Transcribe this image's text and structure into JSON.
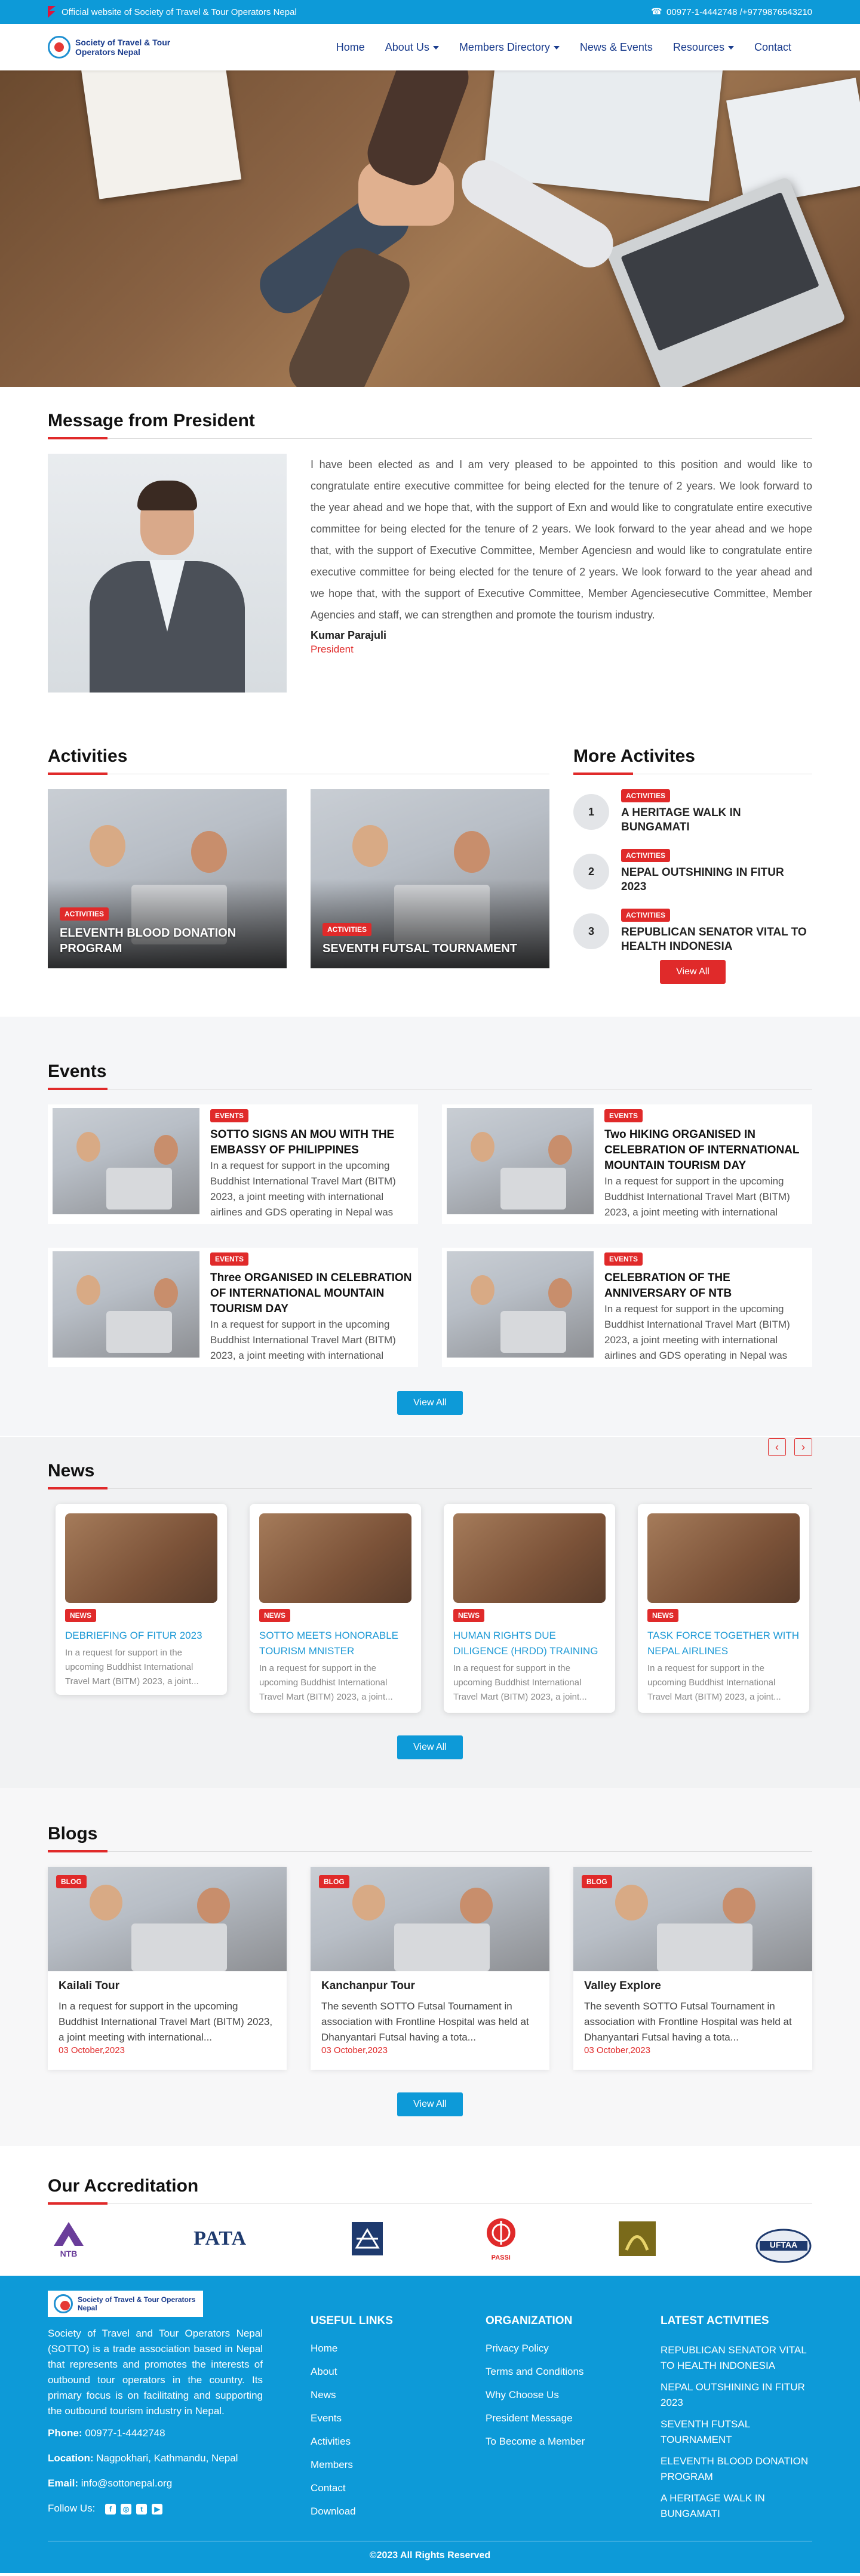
{
  "topbar": {
    "official_text": "Official website of Society of Travel & Tour Operators Nepal",
    "phones": "00977-1-4442748 /+9779876543210"
  },
  "header": {
    "logo_text": "Society of Travel & Tour Operators Nepal",
    "nav": [
      {
        "label": "Home",
        "dropdown": false
      },
      {
        "label": "About Us",
        "dropdown": true
      },
      {
        "label": "Members Directory",
        "dropdown": true
      },
      {
        "label": "News & Events",
        "dropdown": false
      },
      {
        "label": "Resources",
        "dropdown": true
      },
      {
        "label": "Contact",
        "dropdown": false
      }
    ]
  },
  "president": {
    "title": "Message from President",
    "message": "I have been elected as and I am very pleased to be appointed to this position and would like to congratulate entire executive committee for being elected for the tenure of 2 years. We look forward to the year ahead and we hope that, with the support of Exn and would like to congratulate entire executive committee for being elected for the tenure of 2 years. We look forward to the year ahead and we hope that, with the support of Executive Committee, Member Agenciesn and would like to congratulate entire executive committee for being elected for the tenure of 2 years. We look forward to the year ahead and we hope that, with the support of Executive Committee, Member Agenciesecutive Committee, Member Agencies and staff, we can strengthen and promote the tourism industry.",
    "name": "Kumar Parajuli",
    "role": "President"
  },
  "activities": {
    "title": "Activities",
    "cards": [
      {
        "badge": "ACTIVITIES",
        "title": "ELEVENTH BLOOD DONATION PROGRAM"
      },
      {
        "badge": "ACTIVITIES",
        "title": "SEVENTH FUTSAL TOURNAMENT"
      }
    ]
  },
  "more_activities": {
    "title": "More Activites",
    "items": [
      {
        "num": "1",
        "badge": "ACTIVITIES",
        "title": "A HERITAGE WALK IN BUNGAMATI"
      },
      {
        "num": "2",
        "badge": "ACTIVITIES",
        "title": "NEPAL OUTSHINING IN FITUR 2023"
      },
      {
        "num": "3",
        "badge": "ACTIVITIES",
        "title": "REPUBLICAN SENATOR VITAL TO HEALTH INDONESIA"
      }
    ],
    "view_all": "View All"
  },
  "events": {
    "title": "Events",
    "items": [
      {
        "badge": "EVENTS",
        "title": "SOTTO SIGNS AN MOU WITH THE EMBASSY OF PHILIPPINES",
        "desc": "In a request for support in the upcoming Buddhist International Travel Mart (BITM) 2023, a joint meeting with international airlines and GDS operating in Nepal was held"
      },
      {
        "badge": "EVENTS",
        "title": "Two HIKING ORGANISED IN CELEBRATION OF INTERNATIONAL MOUNTAIN TOURISM DAY",
        "desc": "In a request for support in the upcoming Buddhist International Travel Mart (BITM) 2023, a joint meeting with international airlines and GDS operating in Nepal was held"
      },
      {
        "badge": "EVENTS",
        "title": "Three ORGANISED IN CELEBRATION OF INTERNATIONAL MOUNTAIN TOURISM DAY",
        "desc": "In a request for support in the upcoming Buddhist International Travel Mart (BITM) 2023, a joint meeting with international airlines and GDS operating in Nepal was held"
      },
      {
        "badge": "EVENTS",
        "title": "CELEBRATION OF THE ANNIVERSARY OF NTB",
        "desc": "In a request for support in the upcoming Buddhist International Travel Mart (BITM) 2023, a joint meeting with international airlines and GDS operating in Nepal was held"
      }
    ],
    "view_all": "View All"
  },
  "news": {
    "title": "News",
    "prev": "‹",
    "next": "›",
    "items": [
      {
        "badge": "NEWS",
        "title": "DEBRIEFING OF FITUR 2023",
        "desc": "In a request for support in the upcoming Buddhist International Travel Mart (BITM) 2023, a joint..."
      },
      {
        "badge": "NEWS",
        "title": "SOTTO MEETS HONORABLE TOURISM MNISTER",
        "desc": "In a request for support in the upcoming Buddhist International Travel Mart (BITM) 2023, a joint..."
      },
      {
        "badge": "NEWS",
        "title": "HUMAN RIGHTS DUE DILIGENCE (HRDD) TRAINING",
        "desc": "In a request for support in the upcoming Buddhist International Travel Mart (BITM) 2023, a joint..."
      },
      {
        "badge": "NEWS",
        "title": "TASK FORCE TOGETHER WITH NEPAL AIRLINES",
        "desc": "In a request for support in the upcoming Buddhist International Travel Mart (BITM) 2023, a joint..."
      }
    ],
    "view_all": "View All"
  },
  "blogs": {
    "title": "Blogs",
    "items": [
      {
        "badge": "BLOG",
        "title": "Kailali Tour",
        "desc": "In a request for support in the upcoming Buddhist International Travel Mart (BITM) 2023, a joint meeting with international...",
        "date": "03 October,2023"
      },
      {
        "badge": "BLOG",
        "title": "Kanchanpur Tour",
        "desc": "The seventh SOTTO Futsal Tournament in association with Frontline Hospital was held at Dhanyantari Futsal having a tota...",
        "date": "03 October,2023"
      },
      {
        "badge": "BLOG",
        "title": "Valley Explore",
        "desc": "The seventh SOTTO Futsal Tournament in association with Frontline Hospital was held at Dhanyantari Futsal having a tota...",
        "date": "03 October,2023"
      }
    ],
    "view_all": "View All"
  },
  "accreditation": {
    "title": "Our Accreditation",
    "logos": [
      {
        "label": "NTB",
        "color": "#6a3d9a"
      },
      {
        "label": "PATA",
        "color": "#1e3a6e"
      },
      {
        "label": "",
        "color": "#1e3a6e"
      },
      {
        "label": "PASSI",
        "color": "#e02a2a"
      },
      {
        "label": "",
        "color": "#7a6a1a"
      },
      {
        "label": "UFTAA",
        "color": "#1e3a6e"
      }
    ]
  },
  "footer": {
    "logo_text": "Society of Travel & Tour Operators Nepal",
    "about": "Society of Travel and Tour Operators Nepal (SOTTO) is a trade association based in Nepal that represents and promotes the interests of outbound tour operators in the country. Its primary focus is on facilitating and supporting the outbound tourism industry in Nepal.",
    "phone_label": "Phone:",
    "phone": "00977-1-4442748",
    "location_label": "Location:",
    "location": "Nagpokhari, Kathmandu, Nepal",
    "email_label": "Email:",
    "email": "info@sottonepal.org",
    "follow": "Follow Us:",
    "useful_title": "USEFUL LINKS",
    "useful": [
      "Home",
      "About",
      "News",
      "Events",
      "Activities",
      "Members",
      "Contact",
      "Download"
    ],
    "org_title": "ORGANIZATION",
    "org": [
      "Privacy Policy",
      "Terms and Conditions",
      "Why Choose Us",
      "President Message",
      "To Become a Member"
    ],
    "latest_title": "LATEST ACTIVITIES",
    "latest": [
      "REPUBLICAN SENATOR VITAL TO HEALTH INDONESIA",
      "NEPAL OUTSHINING IN FITUR 2023",
      "SEVENTH FUTSAL TOURNAMENT",
      "ELEVENTH BLOOD DONATION PROGRAM",
      "A HERITAGE WALK IN BUNGAMATI"
    ],
    "copyright": "©2023 All Rights Reserved"
  },
  "colors": {
    "brand_blue": "#0d9ad8",
    "accent_red": "#e02a2a",
    "nav_blue": "#1a3c8d"
  }
}
